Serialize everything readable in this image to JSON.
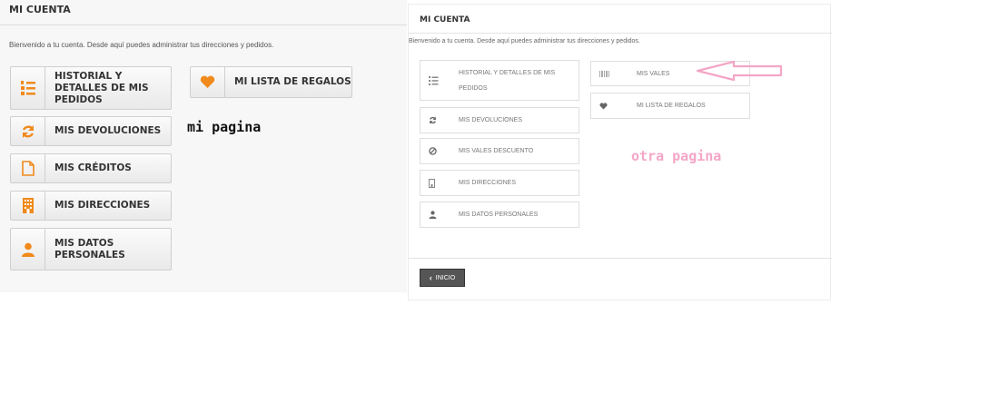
{
  "left": {
    "title": "MI CUENTA",
    "welcome": "Bienvenido a tu cuenta. Desde aquí puedes administrar tus direcciones y pedidos.",
    "buttons": [
      {
        "label": "HISTORIAL Y DETALLES DE MIS PEDIDOS",
        "icon": "list-ordered-icon"
      },
      {
        "label": "MIS DEVOLUCIONES",
        "icon": "refresh-icon"
      },
      {
        "label": "MIS CRÉDITOS",
        "icon": "file-icon"
      },
      {
        "label": "MIS DIRECCIONES",
        "icon": "building-icon"
      },
      {
        "label": "MIS DATOS PERSONALES",
        "icon": "user-icon"
      },
      {
        "label": "MI LISTA DE REGALOS",
        "icon": "heart-icon"
      }
    ],
    "annotation": "mi pagina"
  },
  "right": {
    "title": "MI CUENTA",
    "welcome": "Bienvenido a tu cuenta. Desde aquí puedes administrar tus direcciones y pedidos.",
    "buttons": [
      {
        "label": "HISTORIAL Y DETALLES DE MIS PEDIDOS",
        "icon": "list-ordered-icon"
      },
      {
        "label": "MIS DEVOLUCIONES",
        "icon": "refresh-icon"
      },
      {
        "label": "MIS VALES DESCUENTO",
        "icon": "ban-icon"
      },
      {
        "label": "MIS DIRECCIONES",
        "icon": "building-icon"
      },
      {
        "label": "MIS DATOS PERSONALES",
        "icon": "user-icon"
      },
      {
        "label": "MIS VALES",
        "icon": "barcode-icon"
      },
      {
        "label": "MI LISTA DE REGALOS",
        "icon": "heart-icon"
      }
    ],
    "home_label": "INICIO",
    "annotation": "otra pagina"
  },
  "colors": {
    "accent": "#f08a1c",
    "annotation_pink": "#f4a6c6",
    "home_button": "#555555"
  }
}
